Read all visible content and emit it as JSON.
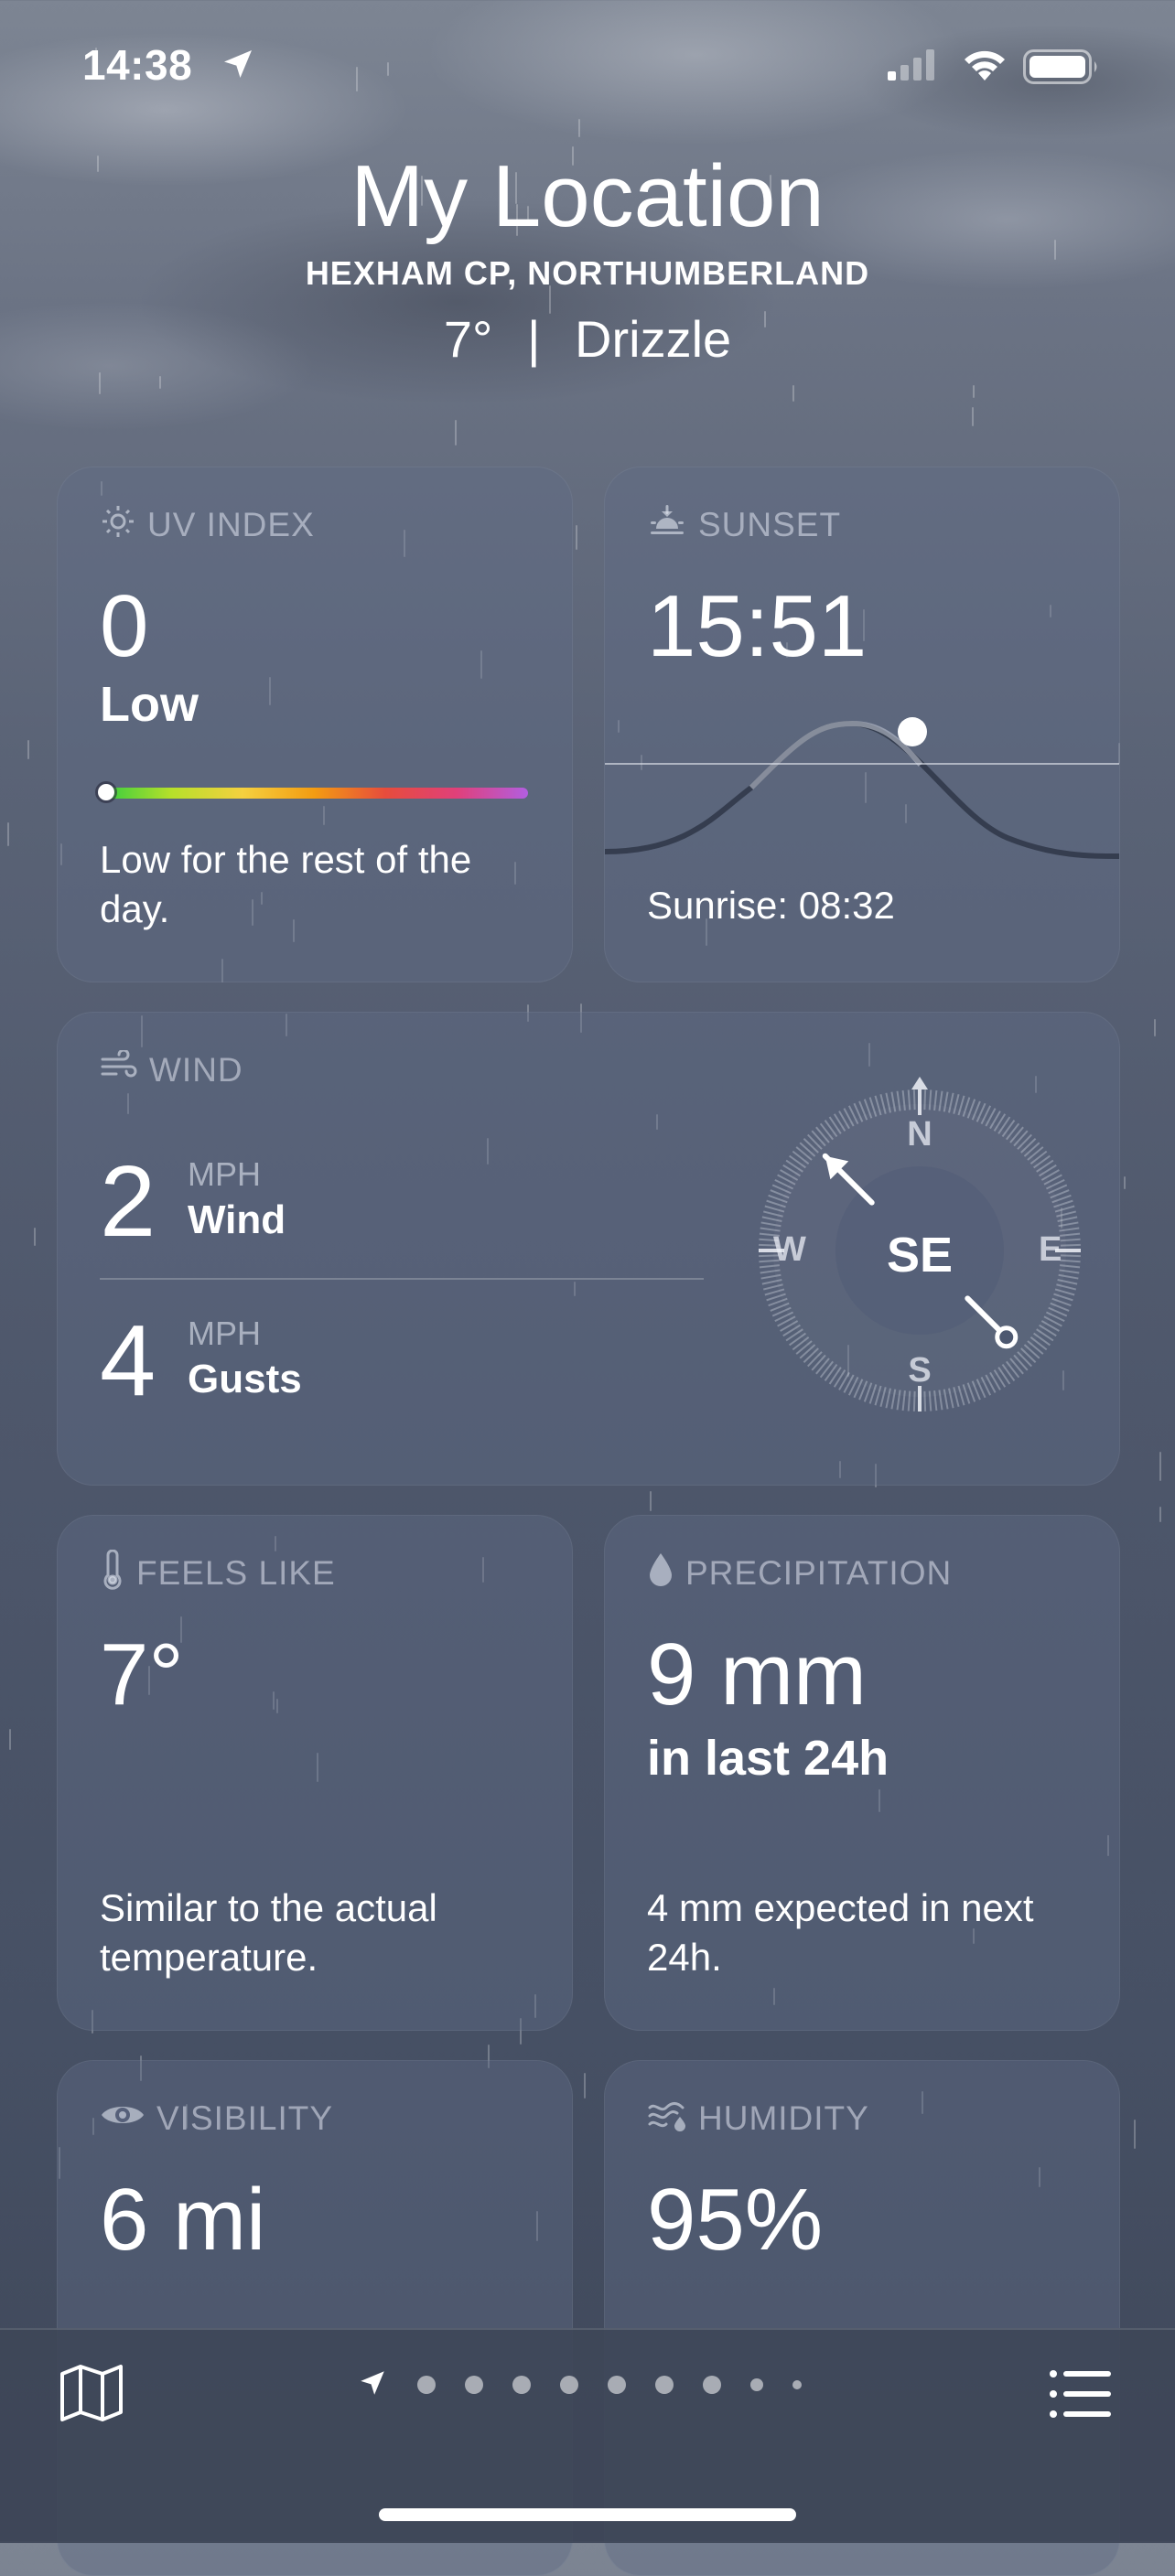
{
  "status_bar": {
    "time": "14:38"
  },
  "header": {
    "title": "My Location",
    "subtitle": "HEXHAM CP, NORTHUMBERLAND",
    "temperature": "7°",
    "separator": "|",
    "condition": "Drizzle"
  },
  "uv": {
    "label": "UV INDEX",
    "value": "0",
    "level": "Low",
    "level_fraction": 0,
    "description": "Low for the rest of the day."
  },
  "sunset": {
    "label": "SUNSET",
    "value": "15:51",
    "sunrise": "Sunrise: 08:32"
  },
  "wind": {
    "label": "WIND",
    "wind_value": "2",
    "wind_unit": "MPH",
    "wind_label": "Wind",
    "gust_value": "4",
    "gust_unit": "MPH",
    "gust_label": "Gusts",
    "direction": "SE",
    "compass": {
      "n": "N",
      "e": "E",
      "s": "S",
      "w": "W"
    }
  },
  "feels_like": {
    "label": "FEELS LIKE",
    "value": "7°",
    "description": "Similar to the actual temperature."
  },
  "precipitation": {
    "label": "PRECIPITATION",
    "value": "9 mm",
    "period": "in last 24h",
    "description": "4 mm expected in next 24h."
  },
  "visibility": {
    "label": "VISIBILITY",
    "value": "6 mi"
  },
  "humidity": {
    "label": "HUMIDITY",
    "value": "95%"
  },
  "colors": {
    "uv_gradient": [
      "#2ecc40",
      "#f4d03f",
      "#e74c3c",
      "#b25ee0"
    ]
  },
  "icons": [
    "location-arrow-icon",
    "signal-icon",
    "wifi-icon",
    "battery-icon",
    "sun-icon",
    "sunset-icon",
    "wind-icon",
    "thermometer-icon",
    "droplet-icon",
    "eye-icon",
    "humidity-icon",
    "map-icon",
    "list-icon"
  ]
}
